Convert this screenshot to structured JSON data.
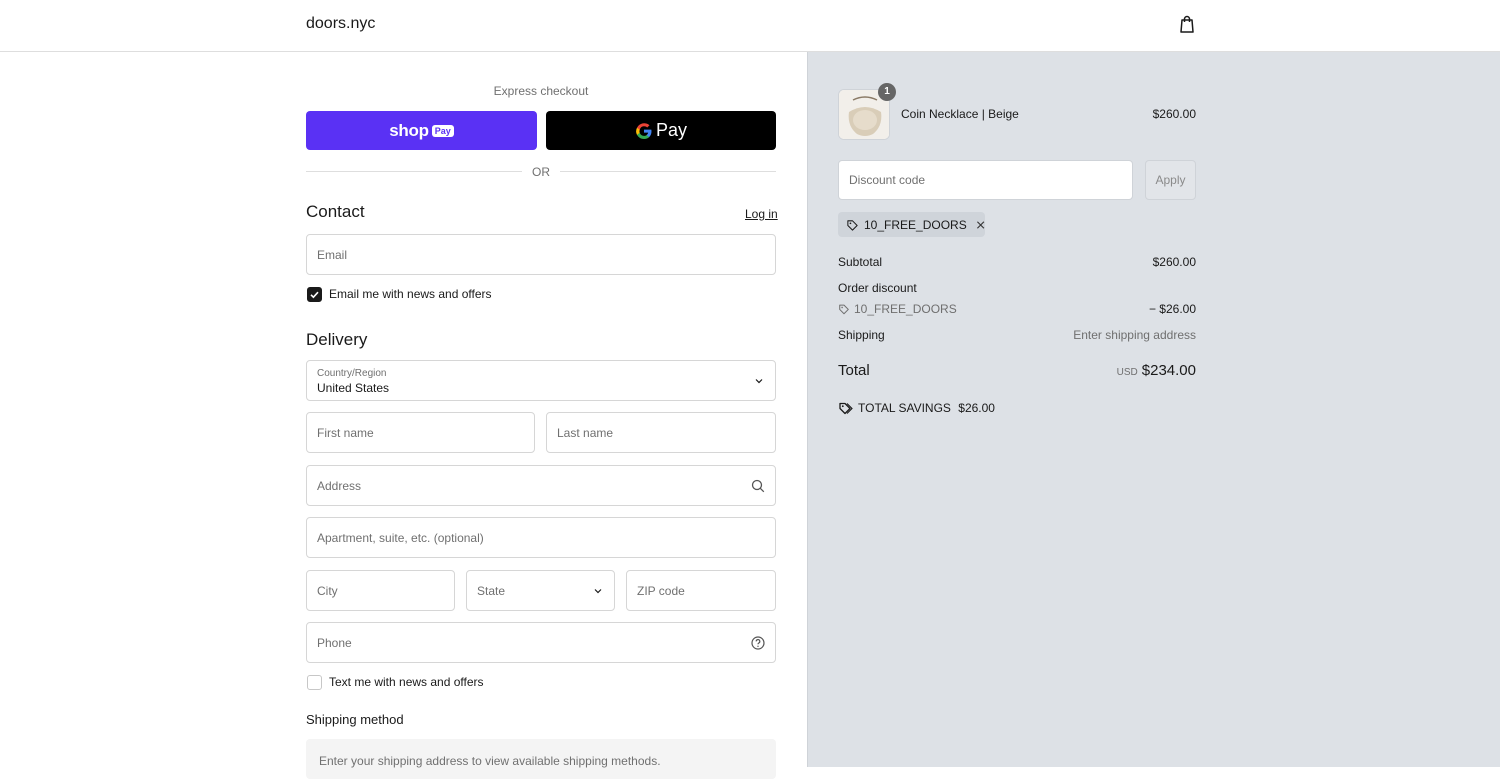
{
  "header": {
    "logo": "doors.nyc",
    "cart_icon": "shopping-bag-icon"
  },
  "express": {
    "label": "Express checkout",
    "shop_pay_word": "shop",
    "shop_pay_chip": "Pay",
    "gpay_text": "Pay",
    "or_label": "OR"
  },
  "contact": {
    "title": "Contact",
    "login_label": "Log in",
    "email_placeholder": "Email",
    "news_label": "Email me with news and offers",
    "news_checked": true
  },
  "delivery": {
    "title": "Delivery",
    "country_label": "Country/Region",
    "country_value": "United States",
    "first_name_placeholder": "First name",
    "last_name_placeholder": "Last name",
    "address_placeholder": "Address",
    "apartment_placeholder": "Apartment, suite, etc. (optional)",
    "city_placeholder": "City",
    "state_placeholder": "State",
    "zip_placeholder": "ZIP code",
    "phone_placeholder": "Phone",
    "text_label": "Text me with news and offers",
    "text_checked": false
  },
  "shipping_method": {
    "title": "Shipping method",
    "message": "Enter your shipping address to view available shipping methods."
  },
  "summary": {
    "product": {
      "name": "Coin Necklace | Beige",
      "price": "$260.00",
      "quantity": "1"
    },
    "discount_placeholder": "Discount code",
    "apply_label": "Apply",
    "applied_code": "10_FREE_DOORS",
    "subtotal_label": "Subtotal",
    "subtotal_value": "$260.00",
    "order_discount_label": "Order discount",
    "discount_code": "10_FREE_DOORS",
    "discount_value": "− $26.00",
    "shipping_label": "Shipping",
    "shipping_value": "Enter shipping address",
    "total_label": "Total",
    "currency": "USD",
    "total_value": "$234.00",
    "savings_label": "TOTAL SAVINGS",
    "savings_value": "$26.00"
  },
  "colors": {
    "shop_pay": "#5a31f4",
    "gpay": "#000000",
    "summary_bg": "#dde1e6"
  }
}
